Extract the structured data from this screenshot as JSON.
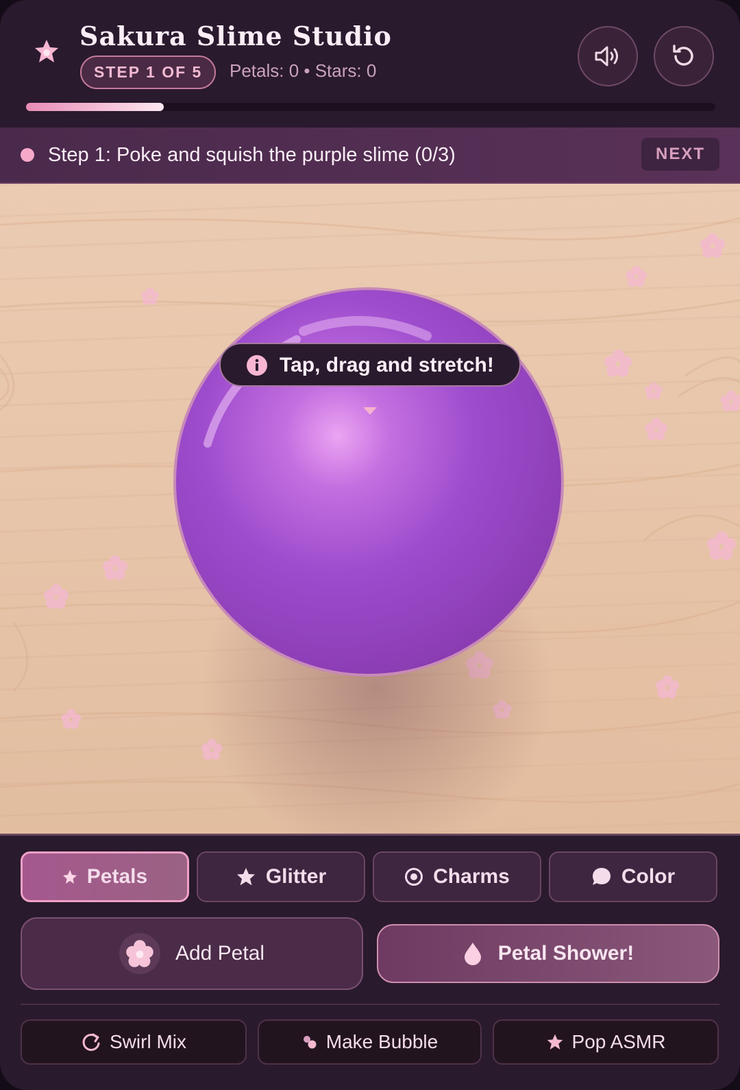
{
  "app": {
    "title": "Sakura Slime Studio",
    "step_badge": "STEP 1 OF 5",
    "stats": "Petals: 0 • Stars: 0",
    "progress": 0.2,
    "buttons": {
      "sound_icon": "speaker-icon",
      "reset_icon": "rotate-icon"
    }
  },
  "instruction": {
    "text": "Step 1: Poke and squish the purple slime (0/3)",
    "next_label": "NEXT"
  },
  "play_area": {
    "tooltip": "Tap, drag and stretch!",
    "slime_color": "#9d4ccd"
  },
  "tabs": [
    {
      "label": "Petals",
      "icon": "petal-icon",
      "active": true
    },
    {
      "label": "Glitter",
      "icon": "star-icon",
      "active": false
    },
    {
      "label": "Charms",
      "icon": "target-icon",
      "active": false
    },
    {
      "label": "Color",
      "icon": "speech-bubble-icon",
      "active": false
    }
  ],
  "actions": {
    "add_petal": "Add Petal",
    "petal_shower": "Petal Shower!"
  },
  "mini_actions": [
    {
      "label": "Swirl Mix",
      "icon": "refresh-icon"
    },
    {
      "label": "Make Bubble",
      "icon": "bubbles-icon"
    },
    {
      "label": "Pop ASMR",
      "icon": "star-icon"
    }
  ],
  "colors": {
    "background": "#2a1a2e",
    "accent_pink": "#f0a1c6",
    "wood": "#e7c5aa"
  }
}
